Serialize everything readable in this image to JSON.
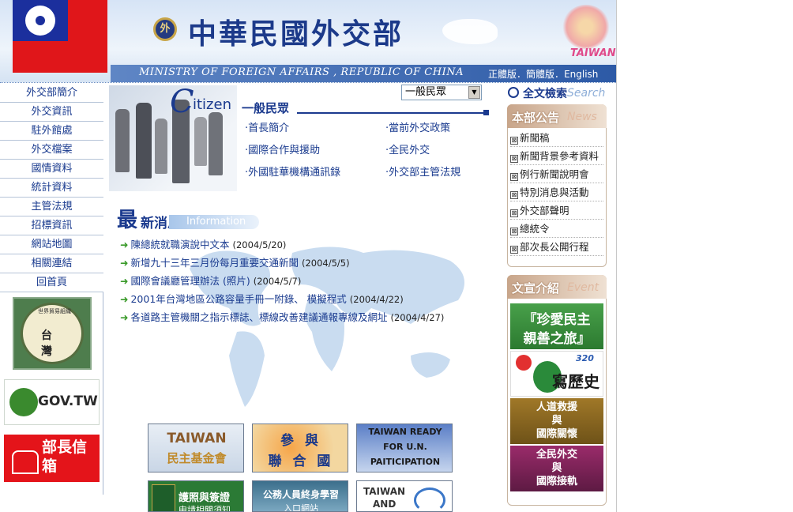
{
  "header": {
    "title": "中華民國外交部",
    "seal_text": "外",
    "ministry": "MINISTRY OF FOREIGN AFFAIRS , REPUBLIC OF CHINA",
    "lang": {
      "traditional": "正體版",
      "sep1": "．",
      "simplified": "簡體版",
      "sep2": "．",
      "english": "English"
    },
    "taiwan_logo": "TAIWAN"
  },
  "leftnav": {
    "items": [
      "外交部簡介",
      "外交資訊",
      "駐外館處",
      "外交檔案",
      "國情資料",
      "統計資料",
      "主管法規",
      "招標資訊",
      "網站地圖",
      "相關連結",
      "回首頁"
    ]
  },
  "left_banners": {
    "seal_text": "台 灣",
    "seal_ring": "世界貿易組織",
    "gov": "GOV.TW",
    "mailbox": "部長信箱"
  },
  "citizen": {
    "c": "C",
    "itizen": "itizen",
    "cn": "一般民眾",
    "select_value": "一般民眾",
    "links": [
      "首長簡介",
      "當前外交政策",
      "國際合作與援助",
      "全民外交",
      "外國駐華機構通訊錄",
      "外交部主管法規"
    ]
  },
  "news": {
    "big": "最",
    "small": "新消息",
    "info": "Information",
    "items": [
      {
        "text": "陳總統就職演說中文本",
        "date": "(2004/5/20)"
      },
      {
        "text": "新增九十三年三月份每月重要交通新聞",
        "date": "(2004/5/5)"
      },
      {
        "text": "國際會議廳管理辦法 (照片)",
        "date": "(2004/5/7)"
      },
      {
        "text": "2001年台灣地區公路容量手冊一附錄、 模擬程式",
        "date": "(2004/4/22)"
      },
      {
        "text": "各道路主管機關之指示標誌、標線改善建議通報專線及網址",
        "date": "(2004/4/27)"
      }
    ]
  },
  "bottom_banners": {
    "b1_top": "TAIWAN",
    "b1_bottom": "民主基金會",
    "b2_top": "參 與",
    "b2_bottom": "聯 合 國",
    "b3_l1": "TAIWAN READY",
    "b3_l2": "FOR U.N.",
    "b3_l3": "PAITICIPATION",
    "b4_text": "護照與簽證",
    "b4_sub": "申請相關須知",
    "b5_text": "公務人員終身學習",
    "b5_sub": "入口網站",
    "b6_l1": "TAIWAN",
    "b6_l2": "AND"
  },
  "search": {
    "cn": "全文檢索",
    "en": "Search"
  },
  "announcements": {
    "title": "本部公告",
    "en": "News",
    "items": [
      "新聞稿",
      "新聞背景參考資料",
      "例行新聞說明會",
      "特別消息與活動",
      "外交部聲明",
      "總統令",
      "部次長公開行程"
    ]
  },
  "events": {
    "title": "文宣介紹",
    "en": "Event",
    "e1": "『珍愛民主",
    "e1b": "親善之旅』",
    "e2": "寫歷史",
    "e2_num": "320",
    "e3a": "人道救援",
    "e3b": "與",
    "e3c": "國際關懷",
    "e4a": "全民外交",
    "e4b": "與",
    "e4c": "國際接軌"
  }
}
